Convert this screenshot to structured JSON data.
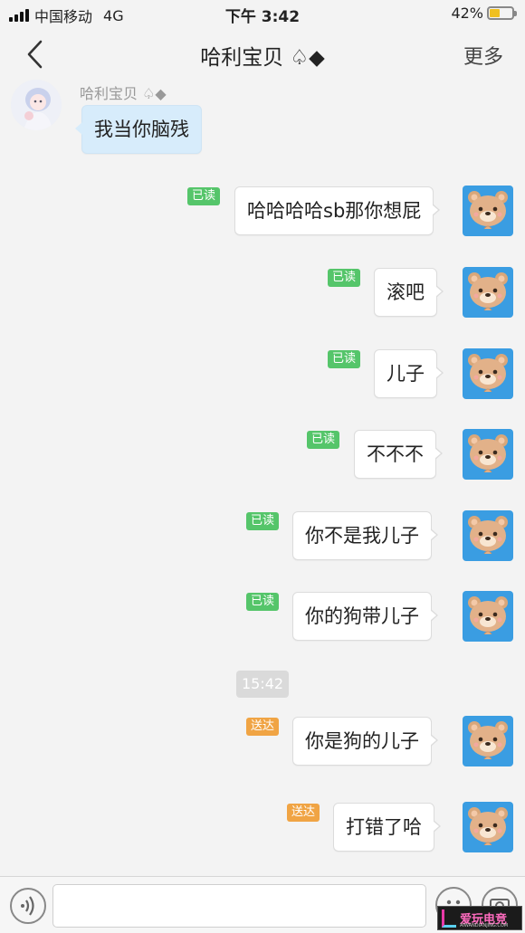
{
  "status_bar": {
    "carrier": "中国移动",
    "network": "4G",
    "time": "下午 3:42",
    "battery": "42%",
    "battery_level": 0.42
  },
  "header": {
    "back_icon": "chevron-left-icon",
    "title": "哈利宝贝 ♤◆",
    "more_label": "更多"
  },
  "incoming": {
    "sender_name": "哈利宝贝 ♤◆",
    "text": "我当你脑残",
    "avatar": "anime-girl-avatar"
  },
  "outgoing_messages": [
    {
      "status": "已读",
      "text": "哈哈哈哈sb那你想屁"
    },
    {
      "status": "已读",
      "text": "滚吧"
    },
    {
      "status": "已读",
      "text": "儿子"
    },
    {
      "status": "已读",
      "text": "不不不"
    },
    {
      "status": "已读",
      "text": "你不是我儿子"
    },
    {
      "status": "已读",
      "text": "你的狗带儿子"
    },
    {
      "status": "送达",
      "text": "你是狗的儿子"
    },
    {
      "status": "送达",
      "text": "打错了哈"
    }
  ],
  "timestamp": "15:42",
  "input_bar": {
    "voice_icon": "voice-icon",
    "text_value": "",
    "emoji_icon": "emoji-icon",
    "camera_icon": "camera-icon"
  },
  "watermark": {
    "text": "爱玩电竞",
    "subtext": "AIWANDIANJING.COM"
  },
  "colors": {
    "read_badge": "#55c56a",
    "sent_badge": "#f0a444",
    "incoming_bubble": "#d7ecfb",
    "outgoing_bubble": "#ffffff",
    "avatar_bear_bg": "#3a9de2"
  }
}
